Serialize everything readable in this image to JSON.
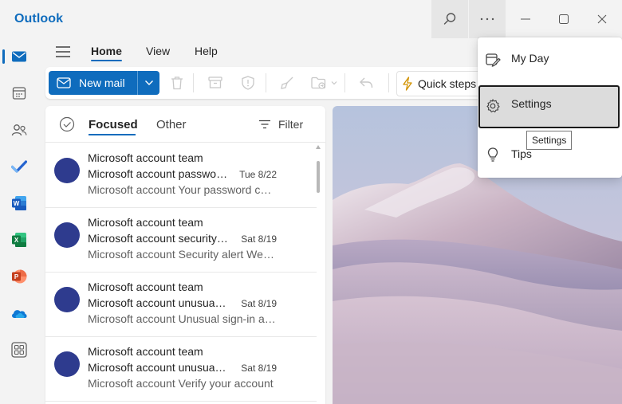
{
  "app": {
    "title": "Outlook"
  },
  "window_controls": [
    "search-icon",
    "more-icon",
    "minimize-icon",
    "maximize-icon",
    "close-icon"
  ],
  "rail": {
    "items": [
      "mail-icon",
      "calendar-icon",
      "people-icon",
      "todo-icon",
      "word-icon",
      "excel-icon",
      "powerpoint-icon",
      "onedrive-icon",
      "apps-icon"
    ],
    "active": "mail-icon"
  },
  "ribbon": {
    "tabs": [
      {
        "label": "Home",
        "active": true
      },
      {
        "label": "View",
        "active": false
      },
      {
        "label": "Help",
        "active": false
      }
    ]
  },
  "toolbar": {
    "new_mail_label": "New mail",
    "quick_steps_label": "Quick steps"
  },
  "mail_list": {
    "tabs": {
      "focused": "Focused",
      "other": "Other"
    },
    "filter_label": "Filter",
    "messages": [
      {
        "sender": "Microsoft account team",
        "subject": "Microsoft account password change",
        "date": "Tue 8/22",
        "preview": "Microsoft account Your password changed"
      },
      {
        "sender": "Microsoft account team",
        "subject": "Microsoft account security info",
        "date": "Sat 8/19",
        "preview": "Microsoft account Security alert We noticed"
      },
      {
        "sender": "Microsoft account team",
        "subject": "Microsoft account unusual sign-in",
        "date": "Sat 8/19",
        "preview": "Microsoft account Unusual sign-in activity"
      },
      {
        "sender": "Microsoft account team",
        "subject": "Microsoft account unusual sign-in",
        "date": "Sat 8/19",
        "preview": "Microsoft account Verify your account"
      }
    ]
  },
  "more_menu": {
    "items": [
      {
        "label": "My Day",
        "icon": "my-day-icon"
      },
      {
        "label": "Settings",
        "icon": "gear-icon",
        "hovered": true
      },
      {
        "label": "Tips",
        "icon": "lightbulb-icon"
      }
    ],
    "tooltip": "Settings"
  },
  "colors": {
    "accent": "#0f6cbd",
    "avatar": "#2e3b8e",
    "background": "#f3f3f3"
  }
}
